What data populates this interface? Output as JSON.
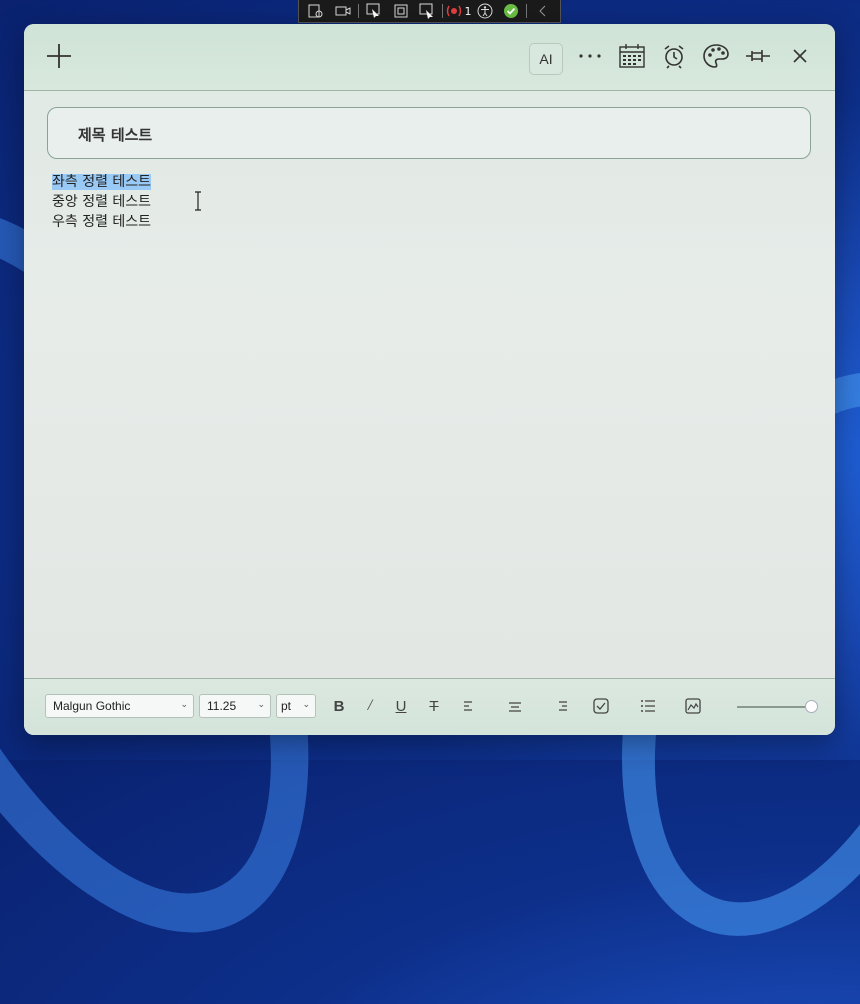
{
  "debug_toolbar": {
    "tools": [
      "live-visual-tree-icon",
      "camera-icon",
      "select-element-icon",
      "layout-adorner-icon",
      "track-focus-icon",
      "binding-failures-icon",
      "accessibility-icon",
      "checkmark-icon",
      "collapse-icon"
    ],
    "binding_failures_count": "1"
  },
  "window": {
    "add_label": "+",
    "ai_label": "AI",
    "more_label": "···",
    "title_field": {
      "value": "제목 테스트"
    },
    "body_lines": [
      {
        "text": "좌측 정렬 테스트",
        "selected": true
      },
      {
        "text": "중앙 정렬 테스트",
        "selected": false
      },
      {
        "text": "우측 정렬 테스트",
        "selected": false
      }
    ]
  },
  "format_bar": {
    "font_family": "Malgun Gothic",
    "font_size": "11.25",
    "unit": "pt",
    "bold": "B",
    "italic": "/",
    "underline": "U",
    "strike": "T",
    "zoom_fraction": 1.0
  },
  "colors": {
    "selection": "#99c9f5",
    "title_border": "#8aa396",
    "titlebar_bg": "#cfe3d6"
  }
}
